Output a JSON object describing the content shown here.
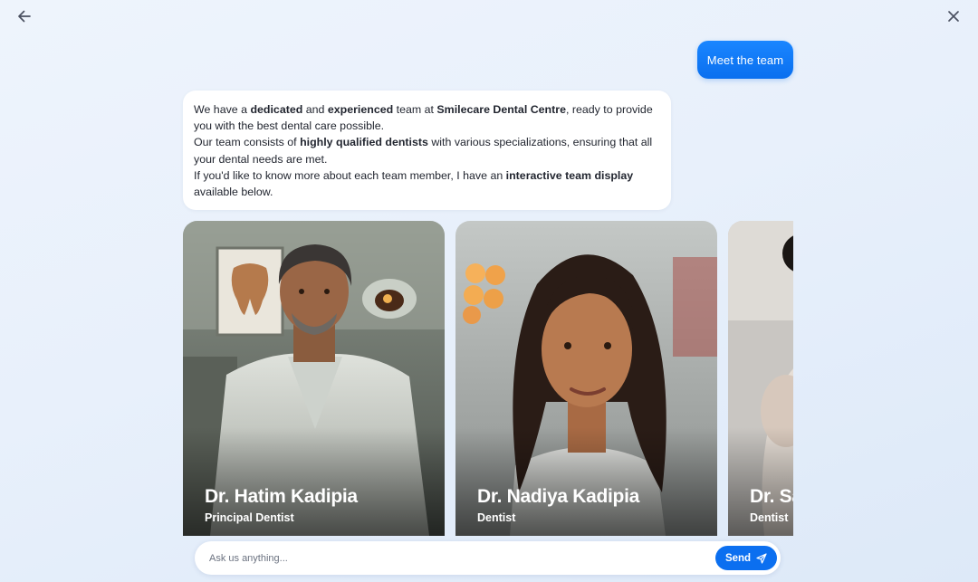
{
  "nav": {
    "back_icon": "arrow-left-icon",
    "close_icon": "close-icon"
  },
  "chat": {
    "user_message": "Meet the team",
    "bot_message": {
      "p1_a": "We have a ",
      "p1_b": "dedicated",
      "p1_c": " and ",
      "p1_d": "experienced",
      "p1_e": " team at ",
      "p1_f": "Smilecare Dental Centre",
      "p1_g": ", ready to provide you with the best dental care possible.",
      "p2_a": "Our team consists of ",
      "p2_b": "highly qualified dentists",
      "p2_c": " with various specializations, ensuring that all your dental needs are met.",
      "p3_a": "If you'd like to know more about each team member, I have an ",
      "p3_b": "interactive team display",
      "p3_c": " available below."
    }
  },
  "team": [
    {
      "name": "Dr. Hatim Kadipia",
      "role": "Principal Dentist"
    },
    {
      "name": "Dr. Nadiya Kadipia",
      "role": "Dentist"
    },
    {
      "name": "Dr. Sa",
      "role": "Dentist"
    }
  ],
  "composer": {
    "placeholder": "Ask us anything...",
    "send_label": "Send",
    "send_icon": "send-icon"
  },
  "colors": {
    "accent": "#0b6ff0",
    "background": "#e8f0fb"
  }
}
